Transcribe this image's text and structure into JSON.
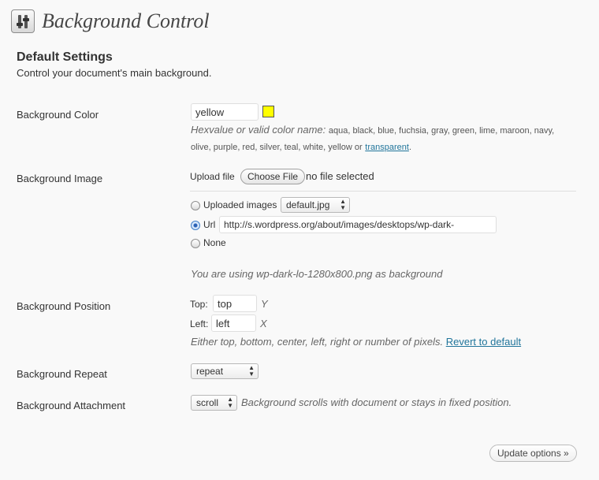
{
  "page": {
    "title": "Background Control",
    "section_title": "Default Settings",
    "section_desc": "Control your document's main background."
  },
  "color": {
    "label": "Background Color",
    "value": "yellow",
    "swatch": "#ffff00",
    "hint_main": "Hexvalue or valid color name:",
    "hint_names": "aqua, black, blue, fuchsia, gray, green, lime, maroon, navy,",
    "hint_names2": "olive, purple, red, silver, teal, white, yellow or",
    "hint_link": "transparent",
    "hint_end": "."
  },
  "image": {
    "label": "Background Image",
    "upload_label": "Upload file",
    "choose_button": "Choose File",
    "no_file": "no file selected",
    "opt_uploaded": "Uploaded images",
    "uploaded_selected": "default.jpg",
    "opt_url": "Url",
    "url_value": "http://s.wordpress.org/about/images/desktops/wp-dark-",
    "opt_none": "None",
    "status": "You are using wp-dark-lo-1280x800.png as background"
  },
  "position": {
    "label": "Background Position",
    "top_label": "Top:",
    "top_value": "top",
    "top_axis": "Y",
    "left_label": "Left:",
    "left_value": "left",
    "left_axis": "X",
    "hint": "Either top, bottom, center, left, right or number of pixels.",
    "revert_link": "Revert to default"
  },
  "repeat": {
    "label": "Background Repeat",
    "value": "repeat"
  },
  "attachment": {
    "label": "Background Attachment",
    "value": "scroll",
    "hint": "Background scrolls with document or stays in fixed position."
  },
  "footer": {
    "update_button": "Update options »"
  }
}
